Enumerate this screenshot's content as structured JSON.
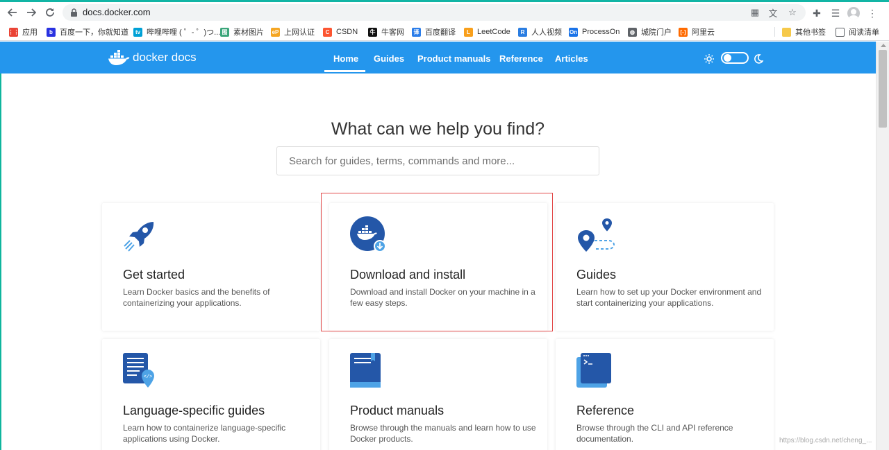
{
  "browser": {
    "url": "docs.docker.com",
    "bookmarks": [
      {
        "label": "应用",
        "color": "#ea4335",
        "glyph": "⋮⋮"
      },
      {
        "label": "百度一下，你就知道",
        "color": "#2932e1",
        "glyph": "b"
      },
      {
        "label": "哔哩哔哩 ( ゜- ゜)つ...",
        "color": "#00a1d6",
        "glyph": "tv"
      },
      {
        "label": "素材图片",
        "color": "#3aa57a",
        "glyph": "图"
      },
      {
        "label": "上网认证",
        "color": "#f5a623",
        "glyph": "eP"
      },
      {
        "label": "CSDN",
        "color": "#fc5531",
        "glyph": "C"
      },
      {
        "label": "牛客网",
        "color": "#111111",
        "glyph": "牛"
      },
      {
        "label": "百度翻译",
        "color": "#2b7de9",
        "glyph": "译"
      },
      {
        "label": "LeetCode",
        "color": "#f89f1b",
        "glyph": "L"
      },
      {
        "label": "人人视频",
        "color": "#2a7de1",
        "glyph": "R"
      },
      {
        "label": "ProcessOn",
        "color": "#1a73e8",
        "glyph": "On"
      },
      {
        "label": "城院门户",
        "color": "#5f6368",
        "glyph": "◍"
      },
      {
        "label": "阿里云",
        "color": "#ff6a00",
        "glyph": "[-]"
      }
    ],
    "other_bookmarks": "其他书签",
    "reading_list": "阅读清单"
  },
  "site": {
    "brand": "docker docs",
    "nav": [
      "Home",
      "Guides",
      "Product manuals",
      "Reference",
      "Articles"
    ],
    "active_nav": "Home",
    "accent": "#2496ed"
  },
  "main": {
    "headline": "What can we help you find?",
    "search_placeholder": "Search for guides, terms, commands and more...",
    "cards": [
      {
        "title": "Get started",
        "desc": "Learn Docker basics and the benefits of containerizing your applications.",
        "icon": "rocket-icon"
      },
      {
        "title": "Download and install",
        "desc": "Download and install Docker on your machine in a few easy steps.",
        "icon": "docker-download-icon"
      },
      {
        "title": "Guides",
        "desc": "Learn how to set up your Docker environment and start containerizing your applications.",
        "icon": "map-pin-route-icon"
      },
      {
        "title": "Language-specific guides",
        "desc": "Learn how to containerize language-specific applications using Docker.",
        "icon": "code-document-icon"
      },
      {
        "title": "Product manuals",
        "desc": "Browse through the manuals and learn how to use Docker products.",
        "icon": "book-icon"
      },
      {
        "title": "Reference",
        "desc": "Browse through the CLI and API reference documentation.",
        "icon": "terminal-icon"
      }
    ]
  },
  "watermark": "https://blog.csdn.net/cheng_..."
}
